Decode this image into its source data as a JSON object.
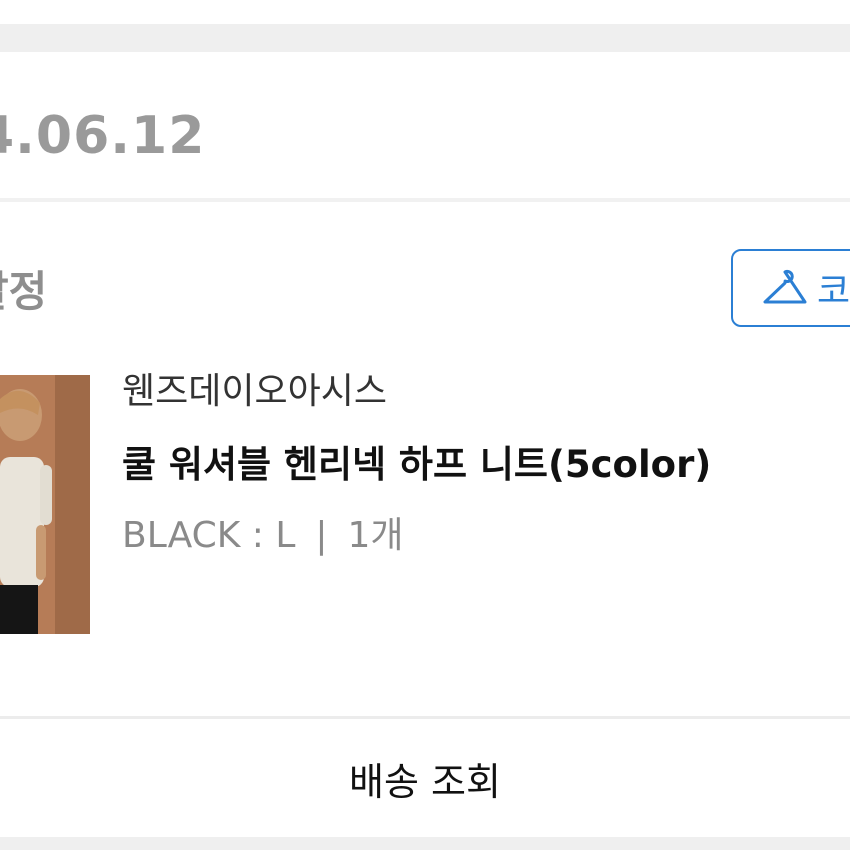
{
  "order": {
    "date": "4.06.12",
    "status": "발정"
  },
  "actions": {
    "coordi_label": "코"
  },
  "product": {
    "brand": "웬즈데이오아시스",
    "name": "쿨 워셔블 헨리넥 하프 니트(5color)",
    "option": "BLACK : L",
    "separator": "|",
    "quantity": "1개"
  },
  "footer": {
    "track_label": "배송 조회"
  },
  "colors": {
    "accent": "#2b7fd4",
    "background_band": "#efefef",
    "muted_text": "#8a8a8a"
  },
  "icons": {
    "coordi_icon": "hanger-icon"
  }
}
